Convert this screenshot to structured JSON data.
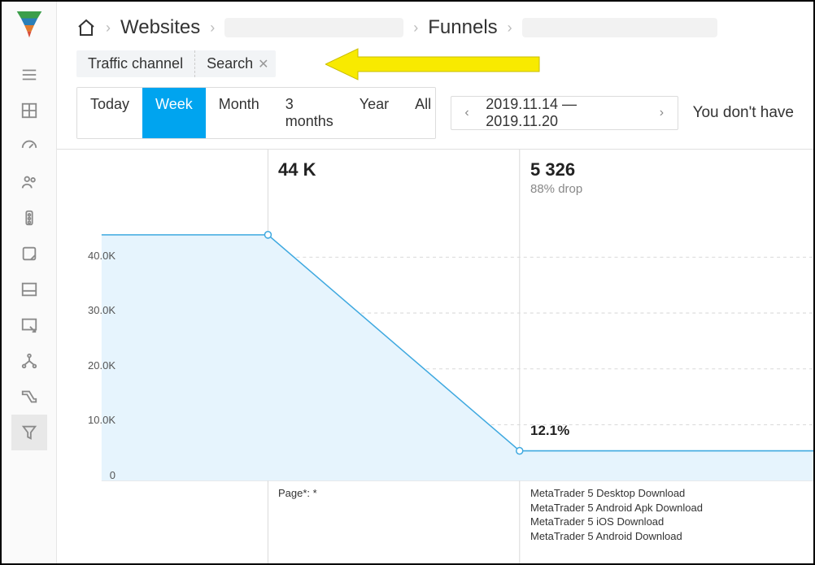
{
  "breadcrumb": {
    "websites": "Websites",
    "funnels": "Funnels"
  },
  "filter": {
    "label": "Traffic channel",
    "value": "Search"
  },
  "periods": {
    "today": "Today",
    "week": "Week",
    "month": "Month",
    "months3": "3 months",
    "year": "Year",
    "all": "All"
  },
  "date_range": "2019.11.14 — 2019.11.20",
  "right_msg": "You don't have",
  "chart_data": {
    "type": "area",
    "ylabel": "",
    "ylim": [
      0,
      44000
    ],
    "ticks": [
      "0",
      "10.0K",
      "20.0K",
      "30.0K",
      "40.0K"
    ],
    "stages": [
      {
        "value": 44000,
        "label": "44 K",
        "drop": "",
        "page": "Page*: *"
      },
      {
        "value": 5326,
        "label": "5 326",
        "drop": "88% drop",
        "pct": "12.1%",
        "pages": [
          "MetaTrader 5 Desktop Download",
          "MetaTrader 5 Android Apk Download",
          "MetaTrader 5 iOS Download",
          "MetaTrader 5 Android Download"
        ]
      }
    ]
  }
}
